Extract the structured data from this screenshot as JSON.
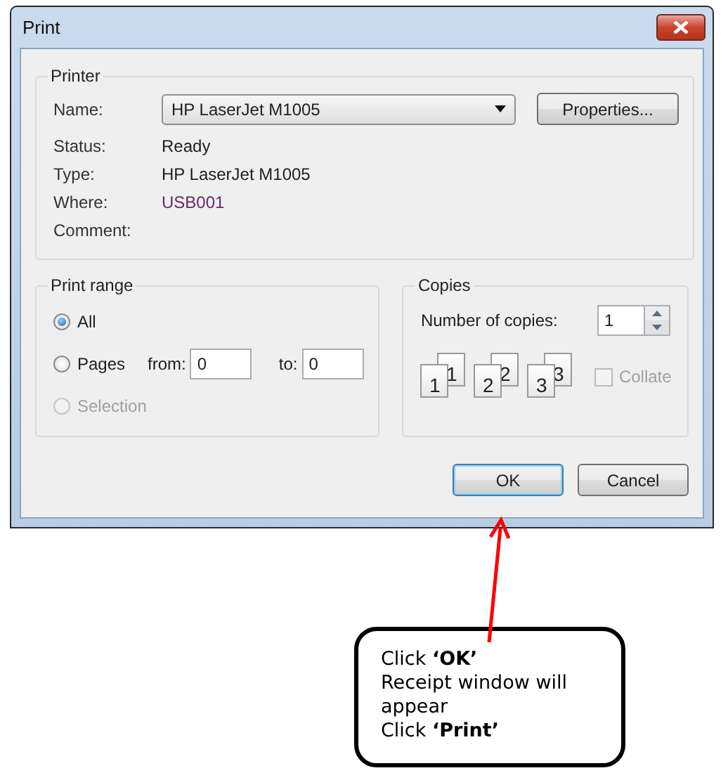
{
  "window": {
    "title": "Print"
  },
  "printer": {
    "legend": "Printer",
    "name_label": "Name:",
    "name_value": "HP LaserJet M1005",
    "properties_button": "Properties...",
    "info": [
      {
        "label": "Status:",
        "value": "Ready"
      },
      {
        "label": "Type:",
        "value": "HP LaserJet M1005"
      },
      {
        "label": "Where:",
        "value": "USB001"
      },
      {
        "label": "Comment:"
      }
    ]
  },
  "print_range": {
    "legend": "Print range",
    "options": [
      {
        "label": "All",
        "selected": true,
        "disabled": false
      },
      {
        "label": "Pages",
        "selected": false,
        "disabled": false
      },
      {
        "label": "Selection",
        "selected": false,
        "disabled": true
      }
    ],
    "from_label": "from:",
    "from_value": "0",
    "to_label": "to:",
    "to_value": "0"
  },
  "copies": {
    "legend": "Copies",
    "count_label": "Number of copies:",
    "count_value": "1",
    "stacks": [
      {
        "back": "1",
        "front": "1"
      },
      {
        "back": "2",
        "front": "2"
      },
      {
        "back": "3",
        "front": "3"
      }
    ],
    "collate": {
      "label": "Collate",
      "checked": false,
      "disabled": true
    }
  },
  "buttons": [
    {
      "label": "OK",
      "default": true
    },
    {
      "label": "Cancel",
      "default": false
    }
  ],
  "callout": {
    "lines": [
      "Click **‘OK’**",
      "Receipt window will appear",
      "Click **‘Print’**"
    ]
  }
}
